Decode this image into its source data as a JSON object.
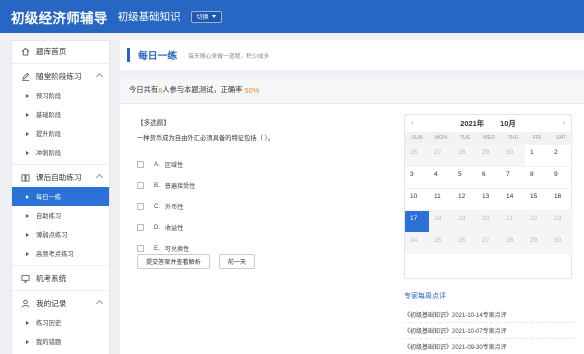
{
  "header": {
    "brand": "初级经济师辅导",
    "subject": "初级基础知识",
    "switch_label": "切换"
  },
  "sidebar": {
    "sections": [
      {
        "label": "题库首页",
        "icon": "home-icon",
        "items": []
      },
      {
        "label": "随堂阶段练习",
        "icon": "pencil-icon",
        "items": [
          "预习阶段",
          "基础阶段",
          "提升阶段",
          "冲刺阶段"
        ]
      },
      {
        "label": "课后自助练习",
        "icon": "book-icon",
        "items": [
          "每日一练",
          "自助练习",
          "薄弱点练习",
          "高频考点练习"
        ],
        "active_index": 0
      },
      {
        "label": "机考系统",
        "icon": "monitor-icon",
        "items": []
      },
      {
        "label": "我的记录",
        "icon": "user-icon",
        "items": [
          "练习历史",
          "我的错题"
        ]
      }
    ]
  },
  "page": {
    "title": "每日一练",
    "subtitle": "每天随心来做一道题，积少成多"
  },
  "stats": {
    "prefix": "今日共有",
    "count": "8",
    "middle": "人参与本题测试，正确率 ",
    "rate": "50%"
  },
  "question": {
    "type": "【多选题】",
    "text": "一种货币成为自由外汇必须具备的特征包括（   ）。",
    "options": [
      {
        "letter": "A.",
        "text": "区域性"
      },
      {
        "letter": "B.",
        "text": "普遍接受性"
      },
      {
        "letter": "C.",
        "text": "外币性"
      },
      {
        "letter": "D.",
        "text": "收益性"
      },
      {
        "letter": "E.",
        "text": "可兑换性"
      }
    ],
    "submit_label": "提交答案并查看解析",
    "prev_label": "前一天"
  },
  "calendar": {
    "year": "2021年",
    "month": "10月",
    "prev": "‹",
    "next": "›",
    "weekdays": [
      "SUN",
      "MON",
      "TUE",
      "WED",
      "THU",
      "FRI",
      "SAT"
    ],
    "days": [
      {
        "d": "26",
        "muted": true
      },
      {
        "d": "27",
        "muted": true
      },
      {
        "d": "28",
        "muted": true
      },
      {
        "d": "29",
        "muted": true
      },
      {
        "d": "30",
        "muted": true
      },
      {
        "d": "1"
      },
      {
        "d": "2"
      },
      {
        "d": "3"
      },
      {
        "d": "4"
      },
      {
        "d": "5"
      },
      {
        "d": "6"
      },
      {
        "d": "7"
      },
      {
        "d": "8"
      },
      {
        "d": "9"
      },
      {
        "d": "10"
      },
      {
        "d": "11"
      },
      {
        "d": "12"
      },
      {
        "d": "13"
      },
      {
        "d": "14"
      },
      {
        "d": "15"
      },
      {
        "d": "16"
      },
      {
        "d": "17",
        "selected": true
      },
      {
        "d": "18",
        "muted": true
      },
      {
        "d": "19",
        "muted": true
      },
      {
        "d": "20",
        "muted": true
      },
      {
        "d": "21",
        "muted": true
      },
      {
        "d": "22",
        "muted": true
      },
      {
        "d": "23",
        "muted": true
      },
      {
        "d": "24",
        "muted": true
      },
      {
        "d": "25",
        "muted": true
      },
      {
        "d": "26",
        "muted": true
      },
      {
        "d": "27",
        "muted": true
      },
      {
        "d": "28",
        "muted": true
      },
      {
        "d": "29",
        "muted": true
      },
      {
        "d": "30",
        "muted": true
      }
    ]
  },
  "reviews": {
    "title": "专家每周点评",
    "items": [
      "《初级基础知识》2021-10-14专家点评",
      "《初级基础知识》2021-10-07专家点评",
      "《初级基础知识》2021-09-30专家点评"
    ]
  },
  "colors": {
    "primary": "#2866c4",
    "active": "#2a72d5",
    "highlight": "#e88a2a"
  }
}
